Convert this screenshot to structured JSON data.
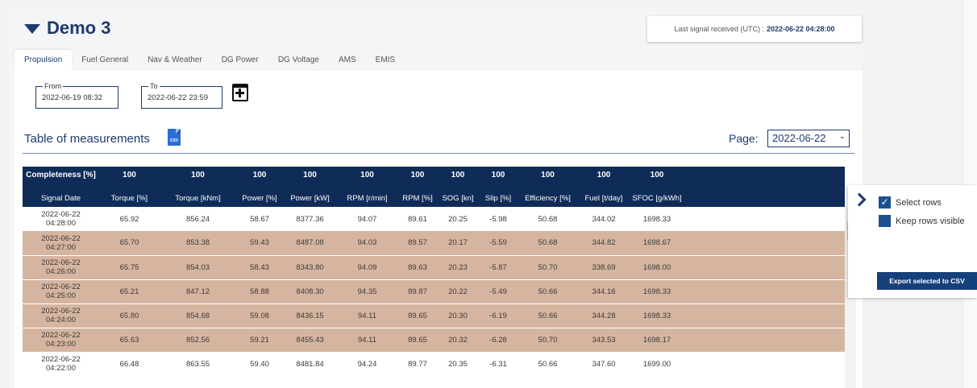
{
  "header": {
    "title": "Demo 3",
    "signal_label": "Last signal received (UTC) :",
    "signal_value": "2022-06-22 04:28:00"
  },
  "tabs": [
    {
      "label": "Propulsion",
      "active": true
    },
    {
      "label": "Fuel General"
    },
    {
      "label": "Nav & Weather"
    },
    {
      "label": "DG Power"
    },
    {
      "label": "DG Voltage"
    },
    {
      "label": "AMS"
    },
    {
      "label": "EMIS"
    }
  ],
  "filters": {
    "from_label": "From",
    "from_value": "2022-06-19 08:32",
    "to_label": "To",
    "to_value": "2022-06-22 23:59"
  },
  "table_section": {
    "heading": "Table of measurements",
    "csv_icon_text": "CSV",
    "page_label": "Page:",
    "page_value": "2022-06-22"
  },
  "table": {
    "completeness_label": "Completeness [%]",
    "completeness": [
      "100",
      "100",
      "100",
      "100",
      "100",
      "100",
      "100",
      "100",
      "100",
      "100",
      "100"
    ],
    "columns": [
      "Signal Date",
      "Torque [%]",
      "Torque [kNm]",
      "Power [%]",
      "Power [kW]",
      "RPM [r/min]",
      "RPM [%]",
      "SOG [kn]",
      "Slip [%]",
      "Efficiency [%]",
      "Fuel [t/day]",
      "SFOC [g/kWh]"
    ],
    "rows": [
      {
        "date": "2022-06-22",
        "time": "04:28:00",
        "selected": false,
        "values": [
          "65.92",
          "856.24",
          "58.67",
          "8377.36",
          "94.07",
          "89.61",
          "20.25",
          "-5.98",
          "50.68",
          "344.02",
          "1698.33"
        ]
      },
      {
        "date": "2022-06-22",
        "time": "04:27:00",
        "selected": true,
        "values": [
          "65.70",
          "853.38",
          "59.43",
          "8487.08",
          "94.03",
          "89.57",
          "20.17",
          "-5.59",
          "50.68",
          "344.82",
          "1698.67"
        ]
      },
      {
        "date": "2022-06-22",
        "time": "04:26:00",
        "selected": true,
        "values": [
          "65.75",
          "854.03",
          "58.43",
          "8343.80",
          "94.09",
          "89.63",
          "20.23",
          "-5.87",
          "50.70",
          "338.69",
          "1698.00"
        ]
      },
      {
        "date": "2022-06-22",
        "time": "04:25:00",
        "selected": true,
        "values": [
          "65.21",
          "847.12",
          "58.88",
          "8408.30",
          "94.35",
          "89.87",
          "20.22",
          "-5.49",
          "50.66",
          "344.16",
          "1698.33"
        ]
      },
      {
        "date": "2022-06-22",
        "time": "04:24:00",
        "selected": true,
        "values": [
          "65.80",
          "854.68",
          "59.08",
          "8436.15",
          "94.11",
          "89.65",
          "20.30",
          "-6.19",
          "50.66",
          "344.28",
          "1698.33"
        ]
      },
      {
        "date": "2022-06-22",
        "time": "04:23:00",
        "selected": true,
        "values": [
          "65.63",
          "852.56",
          "59.21",
          "8455.43",
          "94.11",
          "89.65",
          "20.32",
          "-6.28",
          "50.70",
          "343.53",
          "1698.17"
        ]
      },
      {
        "date": "2022-06-22",
        "time": "04:22:00",
        "selected": false,
        "values": [
          "66.48",
          "863.55",
          "59.40",
          "8481.84",
          "94.24",
          "89.77",
          "20.35",
          "-6.31",
          "50.66",
          "347.60",
          "1699.00"
        ]
      }
    ]
  },
  "side_panel": {
    "select_rows_label": "Select rows",
    "select_rows_checked": true,
    "keep_visible_label": "Keep rows visible",
    "keep_visible_checked": false,
    "export_label": "Export selected to CSV"
  }
}
